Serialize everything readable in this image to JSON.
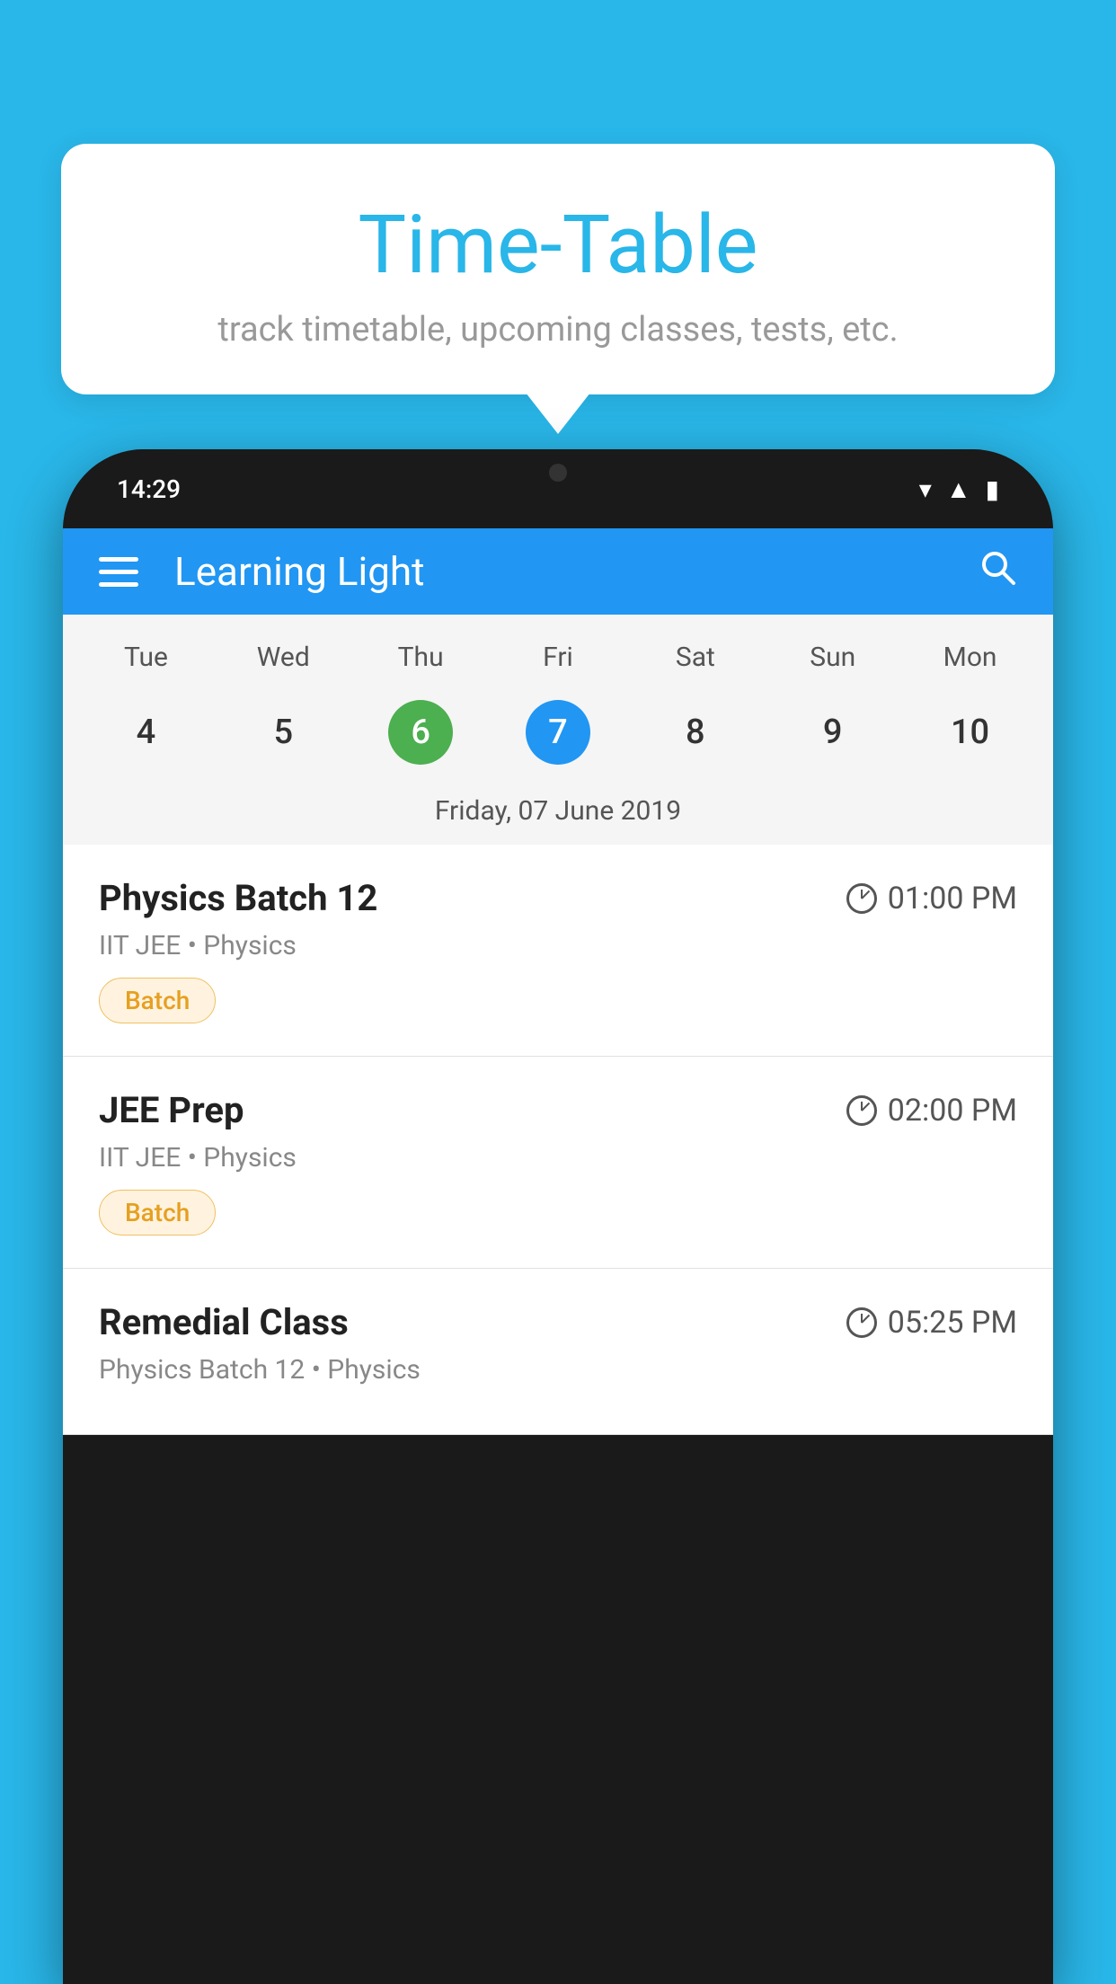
{
  "background_color": "#29b6e8",
  "tooltip": {
    "title": "Time-Table",
    "subtitle": "track timetable, upcoming classes, tests, etc."
  },
  "phone": {
    "status_bar": {
      "time": "14:29"
    },
    "app_header": {
      "title": "Learning Light"
    },
    "calendar": {
      "days": [
        "Tue",
        "Wed",
        "Thu",
        "Fri",
        "Sat",
        "Sun",
        "Mon"
      ],
      "dates": [
        {
          "num": "4",
          "state": "normal"
        },
        {
          "num": "5",
          "state": "normal"
        },
        {
          "num": "6",
          "state": "today"
        },
        {
          "num": "7",
          "state": "selected"
        },
        {
          "num": "8",
          "state": "normal"
        },
        {
          "num": "9",
          "state": "normal"
        },
        {
          "num": "10",
          "state": "normal"
        }
      ],
      "selected_date_label": "Friday, 07 June 2019"
    },
    "schedule": [
      {
        "title": "Physics Batch 12",
        "time": "01:00 PM",
        "subtitle": "IIT JEE • Physics",
        "badge": "Batch"
      },
      {
        "title": "JEE Prep",
        "time": "02:00 PM",
        "subtitle": "IIT JEE • Physics",
        "badge": "Batch"
      },
      {
        "title": "Remedial Class",
        "time": "05:25 PM",
        "subtitle": "Physics Batch 12 • Physics",
        "badge": ""
      }
    ]
  }
}
